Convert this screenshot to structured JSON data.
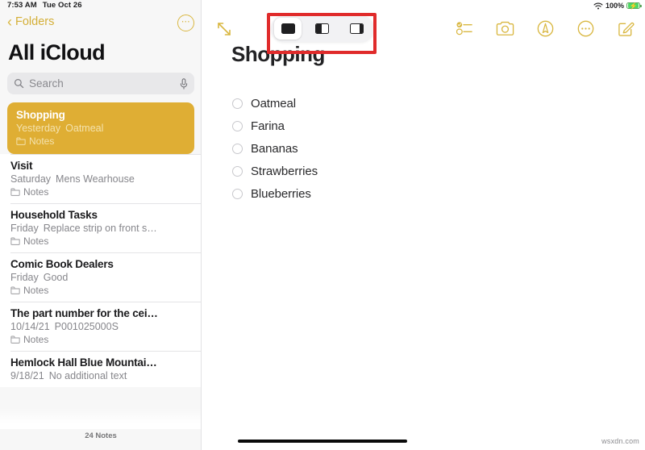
{
  "status_bar": {
    "time": "7:53 AM",
    "date": "Tue Oct 26",
    "wifi_icon": "wifi-icon",
    "battery_percent": "100%",
    "battery_icon": "battery-charging-icon",
    "battery_color": "#4cd964"
  },
  "sidebar": {
    "back_label": "Folders",
    "back_icon": "chevron-left-icon",
    "more_icon": "ellipsis-circle-icon",
    "title": "All iCloud",
    "accent_color": "#d9b740",
    "selected_row_color": "#dfae34",
    "search": {
      "placeholder": "Search",
      "icon": "search-icon",
      "dictation_icon": "microphone-icon"
    },
    "notes": [
      {
        "title": "Shopping",
        "date": "Yesterday",
        "preview": "Oatmeal",
        "folder": "Notes",
        "selected": true
      },
      {
        "title": "Visit",
        "date": "Saturday",
        "preview": "Mens Wearhouse",
        "folder": "Notes",
        "selected": false
      },
      {
        "title": "Household Tasks",
        "date": "Friday",
        "preview": "Replace strip on front s…",
        "folder": "Notes",
        "selected": false
      },
      {
        "title": "Comic Book Dealers",
        "date": "Friday",
        "preview": "Good",
        "folder": "Notes",
        "selected": false
      },
      {
        "title": "The part number for the cei…",
        "date": "10/14/21",
        "preview": "P001025000S",
        "folder": "Notes",
        "selected": false
      },
      {
        "title": "Hemlock Hall Blue Mountai…",
        "date": "9/18/21",
        "preview": "No additional text",
        "folder": "",
        "selected": false
      }
    ],
    "footer_count": "24 Notes"
  },
  "detail": {
    "expand_icon": "expand-diagonal-arrows-icon",
    "multitasking": {
      "highlighted": true,
      "highlight_color": "#e02b2b",
      "options": [
        {
          "label": "Full Screen",
          "icon": "full-screen-icon",
          "selected": true
        },
        {
          "label": "Split View",
          "icon": "split-view-icon",
          "selected": false
        },
        {
          "label": "Slide Over",
          "icon": "slide-over-icon",
          "selected": false
        }
      ]
    },
    "tools": [
      {
        "name": "checklist-button",
        "icon": "checklist-icon"
      },
      {
        "name": "camera-button",
        "icon": "camera-icon"
      },
      {
        "name": "markup-button",
        "icon": "markup-pen-icon"
      },
      {
        "name": "more-button",
        "icon": "ellipsis-circle-icon"
      },
      {
        "name": "compose-button",
        "icon": "compose-icon"
      }
    ],
    "note_title": "Shopping",
    "checklist": [
      {
        "text": "Oatmeal",
        "checked": false
      },
      {
        "text": "Farina",
        "checked": false
      },
      {
        "text": "Bananas",
        "checked": false
      },
      {
        "text": "Strawberries",
        "checked": false
      },
      {
        "text": "Blueberries",
        "checked": false
      }
    ]
  },
  "watermark": "wsxdn.com"
}
